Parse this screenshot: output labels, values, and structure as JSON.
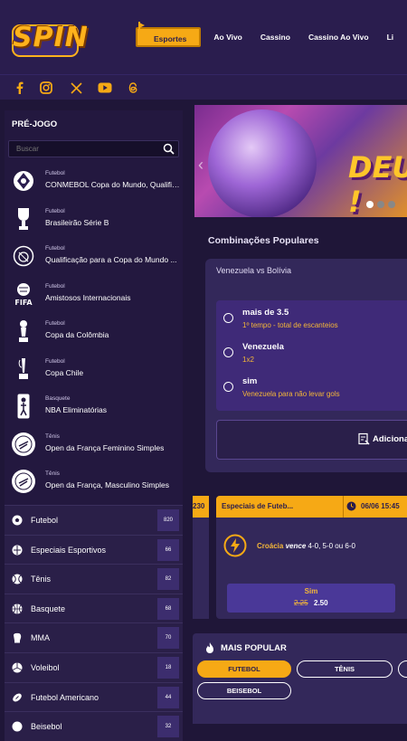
{
  "header": {
    "logo_text": "SPIN",
    "nav": [
      "Esportes",
      "Ao Vivo",
      "Cassino",
      "Cassino Ao Vivo",
      "Li"
    ]
  },
  "social": [
    "facebook-icon",
    "instagram-icon",
    "x-icon",
    "youtube-icon",
    "threads-icon"
  ],
  "sidebar": {
    "title": "PRÉ-JOGO",
    "search_placeholder": "Buscar",
    "prematch": [
      {
        "sport": "Futebol",
        "name": "CONMEBOL Copa do Mundo, Qualificaç..."
      },
      {
        "sport": "Futebol",
        "name": "Brasileirão Série B"
      },
      {
        "sport": "Futebol",
        "name": "Qualificação para a Copa do Mundo ..."
      },
      {
        "sport": "Futebol",
        "name": "Amistosos Internacionais"
      },
      {
        "sport": "Futebol",
        "name": "Copa da Colômbia"
      },
      {
        "sport": "Futebol",
        "name": "Copa Chile"
      },
      {
        "sport": "Basquete",
        "name": "NBA Eliminatórias"
      },
      {
        "sport": "Tênis",
        "name": "Open da França Feminino Simples"
      },
      {
        "sport": "Tênis",
        "name": "Open da França, Masculino Simples"
      }
    ],
    "sports": [
      {
        "label": "Futebol",
        "count": "820"
      },
      {
        "label": "Especiais Esportivos",
        "count": "66"
      },
      {
        "label": "Tênis",
        "count": "82"
      },
      {
        "label": "Basquete",
        "count": "68"
      },
      {
        "label": "MMA",
        "count": "70"
      },
      {
        "label": "Voleibol",
        "count": "18"
      },
      {
        "label": "Futebol Americano",
        "count": "44"
      },
      {
        "label": "Beisebol",
        "count": "32"
      }
    ]
  },
  "banner": {
    "text": "DEU !"
  },
  "combos": {
    "title": "Combinações Populares",
    "match": "Venezuela vs Bolívia",
    "selections": [
      {
        "main": "mais de 3.5",
        "sub": "1º tempo - total de escanteios"
      },
      {
        "main": "Venezuela",
        "sub": "1x2"
      },
      {
        "main": "sim",
        "sub": "Venezuela para não levar gols"
      }
    ],
    "add_label": "Adiciona"
  },
  "bet_card_1": {
    "time": "230"
  },
  "bet_card_2": {
    "category": "Especiais de Futeb...",
    "date": "06/06 15:45",
    "team": "Croácia",
    "verb": "vence",
    "rest": "4-0, 5-0 ou 6-0",
    "odd_label": "Sim",
    "odd_old": "2.25",
    "odd_new": "2.50"
  },
  "popular": {
    "title": "MAIS POPULAR",
    "chips": [
      "FUTEBOL",
      "TÊNIS",
      "BEISEBOL"
    ]
  }
}
